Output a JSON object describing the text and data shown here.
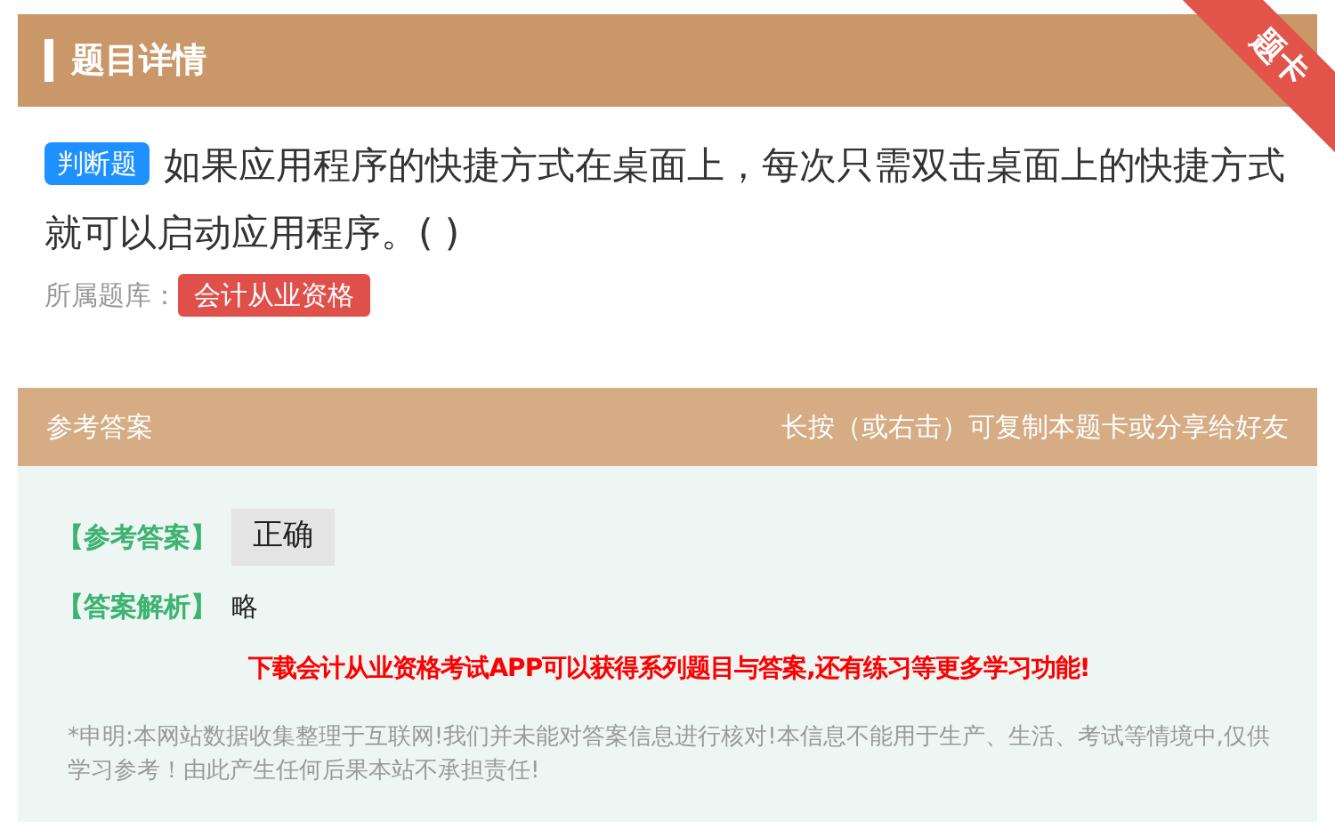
{
  "header": {
    "title": "题目详情",
    "ribbon": "题卡"
  },
  "question": {
    "type_badge": "判断题",
    "text": "如果应用程序的快捷方式在桌面上，每次只需双击桌面上的快捷方式就可以启动应用程序。( )",
    "bank_label": "所属题库：",
    "bank_tag": "会计从业资格"
  },
  "answer_header": {
    "title": "参考答案",
    "hint": "长按（或右击）可复制本题卡或分享给好友"
  },
  "answer": {
    "answer_label": "【参考答案】",
    "answer_value": "正确",
    "analysis_label": "【答案解析】",
    "analysis_value": "略",
    "promo": "下载会计从业资格考试APP可以获得系列题目与答案,还有练习等更多学习功能!",
    "disclaimer": "*申明:本网站数据收集整理于互联网!我们并未能对答案信息进行核对!本信息不能用于生产、生活、考试等情境中,仅供学习参考！由此产生任何后果本站不承担责任!"
  }
}
